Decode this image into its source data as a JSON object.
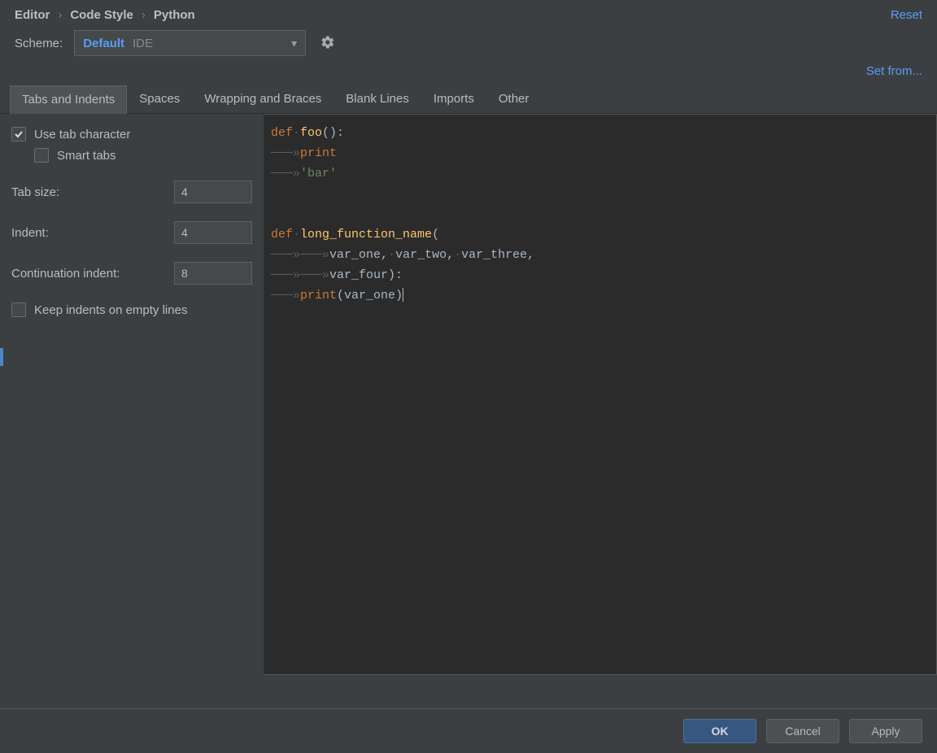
{
  "breadcrumb": {
    "p0": "Editor",
    "p1": "Code Style",
    "p2": "Python"
  },
  "reset": "Reset",
  "scheme": {
    "label": "Scheme:",
    "selected": "Default",
    "suffix": "IDE"
  },
  "setfrom": "Set from...",
  "tabs": {
    "t0": "Tabs and Indents",
    "t1": "Spaces",
    "t2": "Wrapping and Braces",
    "t3": "Blank Lines",
    "t4": "Imports",
    "t5": "Other"
  },
  "settings": {
    "use_tab": "Use tab character",
    "smart_tabs": "Smart tabs",
    "tab_size_label": "Tab size:",
    "tab_size_value": "4",
    "indent_label": "Indent:",
    "indent_value": "4",
    "cont_indent_label": "Continuation indent:",
    "cont_indent_value": "8",
    "keep_empty": "Keep indents on empty lines"
  },
  "buttons": {
    "ok": "OK",
    "cancel": "Cancel",
    "apply": "Apply"
  },
  "code": {
    "kw_def": "def",
    "foo": "foo",
    "print": "print",
    "bar_str": "'bar'",
    "long_fn": "long_function_name",
    "var_one": "var_one",
    "var_two": "var_two",
    "var_three": "var_three",
    "var_four": "var_four"
  }
}
